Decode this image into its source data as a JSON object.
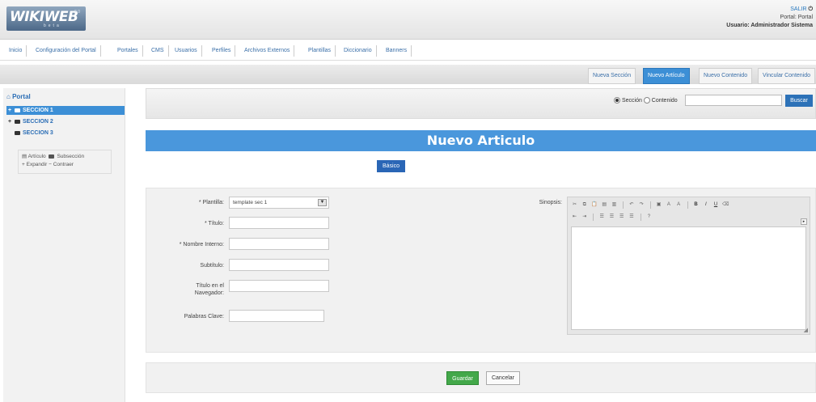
{
  "logo": {
    "text": "WIKIWEB",
    "sub": "beta",
    "tm": "2.0"
  },
  "user": {
    "salir": "SALIR",
    "portal": "Portal: Portal",
    "user": "Usuario: Administrador Sistema"
  },
  "menu": [
    "Inicio",
    "Configuración del Portal",
    "Portales",
    "CMS",
    "Usuarios",
    "Perfiles",
    "Archivos Externos",
    "Plantillas",
    "Diccionario",
    "Banners"
  ],
  "subnav": {
    "tabs": [
      "Nueva Sección",
      "Nuevo Artículo",
      "Nuevo Contenido",
      "Vincular Contenido"
    ],
    "active": "Nuevo Artículo"
  },
  "sidebar": {
    "root": "Portal",
    "items": [
      {
        "toggle": "+",
        "label": "SECCION 1",
        "selected": true
      },
      {
        "toggle": "+",
        "label": "SECCION 2",
        "selected": false
      },
      {
        "toggle": "",
        "label": "SECCION 3",
        "selected": false
      }
    ],
    "legend": {
      "articulo": "Artículo",
      "subseccion": "Subsección",
      "expandir": "Expandir",
      "contraer": "Contraer"
    }
  },
  "search": {
    "radio_seccion": "Sección",
    "radio_contenido": "Contenido",
    "selected": "Sección",
    "input_value": "",
    "button": "Buscar"
  },
  "title": "Nuevo Articulo",
  "tab_basico": "Básico",
  "form": {
    "plantilla_label": "* Plantilla:",
    "plantilla_value": "template sec 1",
    "titulo_label": "* Título:",
    "nombre_interno_label": "* Nombre Interno:",
    "subtitulo_label": "Subtítulo:",
    "titulo_nav_label": "Título en el Navegador:",
    "palabras_clave_label": "Palabras Clave:",
    "sinopsis_label": "Sinopsis:",
    "values": {
      "titulo": "",
      "nombre_interno": "",
      "subtitulo": "",
      "titulo_nav": "",
      "palabras_clave": ""
    }
  },
  "buttons": {
    "guardar": "Guardar",
    "cancelar": "Cancelar"
  },
  "colors": {
    "accent": "#4a97dc",
    "active_tab": "#3c8fd6",
    "guardar": "#43a84a",
    "buscar": "#2d72b8"
  }
}
